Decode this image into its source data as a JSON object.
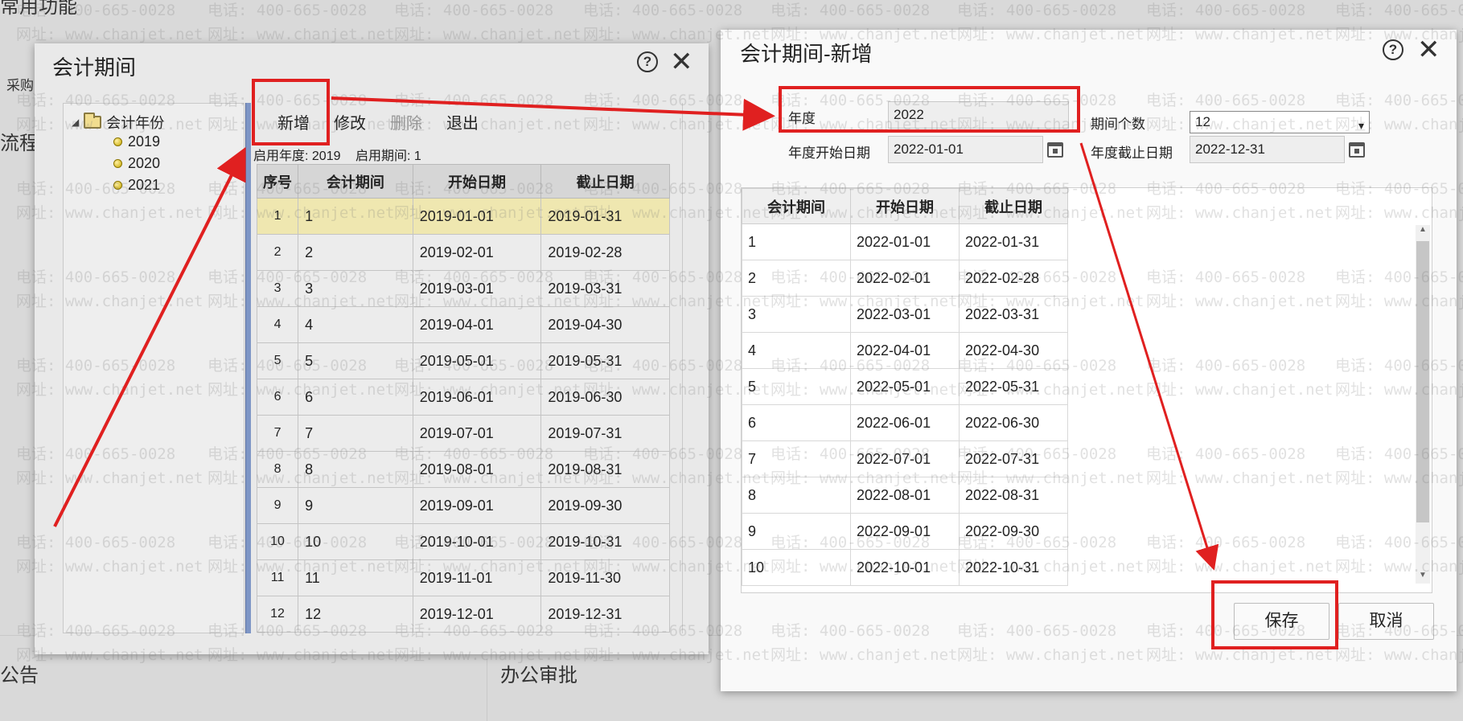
{
  "background": {
    "top_text": "常用功能",
    "side_label_1": "采购",
    "side_label_2": "流程",
    "bottom_label_1": "公告",
    "bottom_label_2": "办公审批",
    "watermark_phone": "电话: 400-665-0028",
    "watermark_site": "网址: www.chanjet.net"
  },
  "left_dialog": {
    "title": "会计期间",
    "tree": {
      "root": "会计年份",
      "years": [
        "2019",
        "2020",
        "2021"
      ]
    },
    "toolbar": {
      "add": "新增",
      "edit": "修改",
      "delete": "删除",
      "exit": "退出"
    },
    "enable_year_label": "启用年度: 2019",
    "enable_period_label": "启用期间: 1",
    "table": {
      "headers": [
        "序号",
        "会计期间",
        "开始日期",
        "截止日期"
      ],
      "rows": [
        [
          "1",
          "1",
          "2019-01-01",
          "2019-01-31"
        ],
        [
          "2",
          "2",
          "2019-02-01",
          "2019-02-28"
        ],
        [
          "3",
          "3",
          "2019-03-01",
          "2019-03-31"
        ],
        [
          "4",
          "4",
          "2019-04-01",
          "2019-04-30"
        ],
        [
          "5",
          "5",
          "2019-05-01",
          "2019-05-31"
        ],
        [
          "6",
          "6",
          "2019-06-01",
          "2019-06-30"
        ],
        [
          "7",
          "7",
          "2019-07-01",
          "2019-07-31"
        ],
        [
          "8",
          "8",
          "2019-08-01",
          "2019-08-31"
        ],
        [
          "9",
          "9",
          "2019-09-01",
          "2019-09-30"
        ],
        [
          "10",
          "10",
          "2019-10-01",
          "2019-10-31"
        ],
        [
          "11",
          "11",
          "2019-11-01",
          "2019-11-30"
        ],
        [
          "12",
          "12",
          "2019-12-01",
          "2019-12-31"
        ]
      ]
    }
  },
  "right_dialog": {
    "title": "会计期间-新增",
    "form": {
      "year_label": "年度",
      "year_value": "2022",
      "period_count_label": "期间个数",
      "period_count_value": "12",
      "start_label": "年度开始日期",
      "start_value": "2022-01-01",
      "end_label": "年度截止日期",
      "end_value": "2022-12-31"
    },
    "table": {
      "headers": [
        "会计期间",
        "开始日期",
        "截止日期"
      ],
      "rows": [
        [
          "1",
          "2022-01-01",
          "2022-01-31"
        ],
        [
          "2",
          "2022-02-01",
          "2022-02-28"
        ],
        [
          "3",
          "2022-03-01",
          "2022-03-31"
        ],
        [
          "4",
          "2022-04-01",
          "2022-04-30"
        ],
        [
          "5",
          "2022-05-01",
          "2022-05-31"
        ],
        [
          "6",
          "2022-06-01",
          "2022-06-30"
        ],
        [
          "7",
          "2022-07-01",
          "2022-07-31"
        ],
        [
          "8",
          "2022-08-01",
          "2022-08-31"
        ],
        [
          "9",
          "2022-09-01",
          "2022-09-30"
        ],
        [
          "10",
          "2022-10-01",
          "2022-10-31"
        ]
      ]
    },
    "save_label": "保存",
    "cancel_label": "取消"
  },
  "colors": {
    "annotation_red": "#e02020",
    "selected_row": "#efe7b0",
    "splitter_blue": "#7e96c6"
  }
}
